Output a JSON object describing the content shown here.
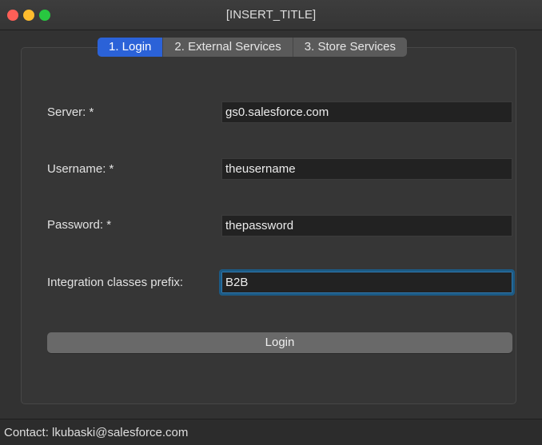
{
  "window": {
    "title": "[INSERT_TITLE]"
  },
  "tabs": [
    {
      "label": "1. Login",
      "active": true
    },
    {
      "label": "2. External Services",
      "active": false
    },
    {
      "label": "3. Store Services",
      "active": false
    }
  ],
  "form": {
    "server": {
      "label": "Server: *",
      "value": "gs0.salesforce.com"
    },
    "username": {
      "label": "Username: *",
      "value": "theusername"
    },
    "password": {
      "label": "Password: *",
      "value": "thepassword"
    },
    "prefix": {
      "label": "Integration classes prefix:",
      "value": "B2B"
    },
    "login_label": "Login"
  },
  "status": {
    "text": "Contact: lkubaski@salesforce.com"
  },
  "colors": {
    "accent": "#2b62d8",
    "focus_ring": "#1c5a84",
    "window_bg": "#323232",
    "traffic_close": "#fe5f57",
    "traffic_minimize": "#febc2e",
    "traffic_maximize": "#28c840"
  }
}
